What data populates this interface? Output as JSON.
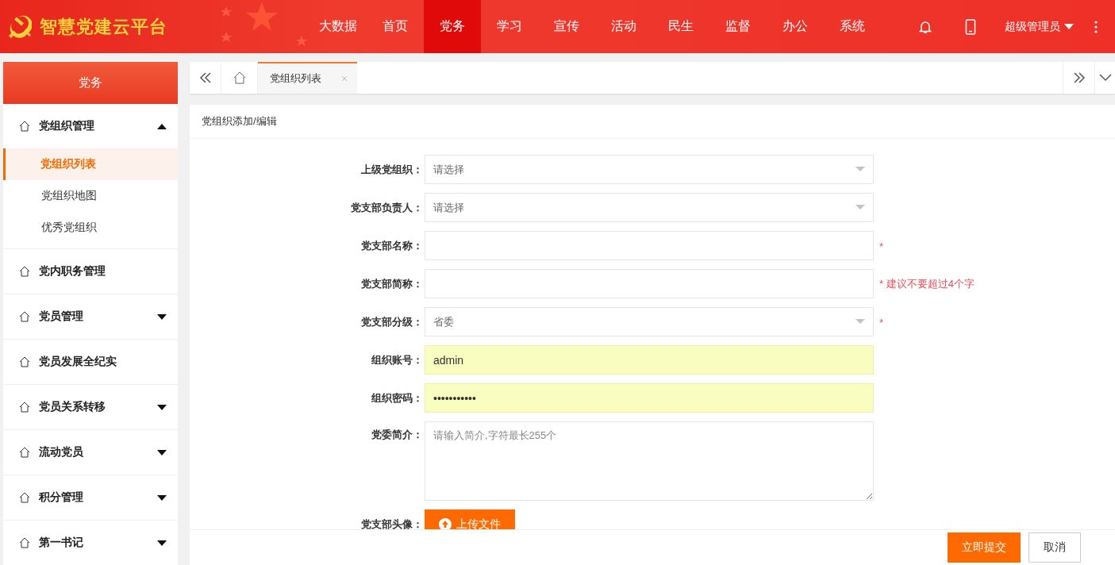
{
  "header": {
    "title": "智慧党建云平台",
    "nav": [
      {
        "label": "大数据",
        "selected": false
      },
      {
        "label": "首页",
        "selected": false
      },
      {
        "label": "党务",
        "selected": true
      },
      {
        "label": "学习",
        "selected": false
      },
      {
        "label": "宣传",
        "selected": false
      },
      {
        "label": "活动",
        "selected": false
      },
      {
        "label": "民生",
        "selected": false
      },
      {
        "label": "监督",
        "selected": false
      },
      {
        "label": "办公",
        "selected": false
      },
      {
        "label": "系统",
        "selected": false
      }
    ],
    "user": "超级管理员"
  },
  "sidebar": {
    "title": "党务",
    "items": [
      {
        "label": "党组织管理",
        "kind": "menu",
        "expanded": true,
        "children": [
          {
            "label": "党组织列表",
            "selected": true
          },
          {
            "label": "党组织地图",
            "selected": false
          },
          {
            "label": "优秀党组织",
            "selected": false
          }
        ]
      },
      {
        "label": "党内职务管理",
        "kind": "link"
      },
      {
        "label": "党员管理",
        "kind": "menu",
        "expanded": false
      },
      {
        "label": "党员发展全纪实",
        "kind": "link"
      },
      {
        "label": "党员关系转移",
        "kind": "menu",
        "expanded": false
      },
      {
        "label": "流动党员",
        "kind": "menu",
        "expanded": false
      },
      {
        "label": "积分管理",
        "kind": "menu",
        "expanded": false
      },
      {
        "label": "第一书记",
        "kind": "menu",
        "expanded": false
      }
    ]
  },
  "tabs": [
    {
      "label": "党组织列表",
      "selected": true
    }
  ],
  "form": {
    "title": "党组织添加/编辑",
    "fields": [
      {
        "label": "上级党组织：",
        "kind": "select",
        "placeholder": "请选择"
      },
      {
        "label": "党支部负责人：",
        "kind": "select",
        "placeholder": "请选择"
      },
      {
        "label": "党支部名称：",
        "kind": "text",
        "required": "*"
      },
      {
        "label": "党支部简称：",
        "kind": "text",
        "required": "*",
        "hint": "建议不要超过4个字"
      },
      {
        "label": "党支部分级：",
        "kind": "select",
        "value": "省委",
        "required": "*"
      },
      {
        "label": "组织账号：",
        "kind": "text",
        "value": "admin",
        "autofilled": true
      },
      {
        "label": "组织密码：",
        "kind": "text",
        "value": "•••••••••••",
        "autofilled": true
      },
      {
        "label": "党委简介：",
        "kind": "textarea",
        "placeholder": "请输入简介,字符最长255个"
      },
      {
        "label": "党支部头像：",
        "kind": "upload",
        "button": "上传文件"
      }
    ],
    "buttons": [
      {
        "label": "立即提交",
        "kind": "primary"
      },
      {
        "label": "取消",
        "kind": "secondary"
      }
    ]
  }
}
